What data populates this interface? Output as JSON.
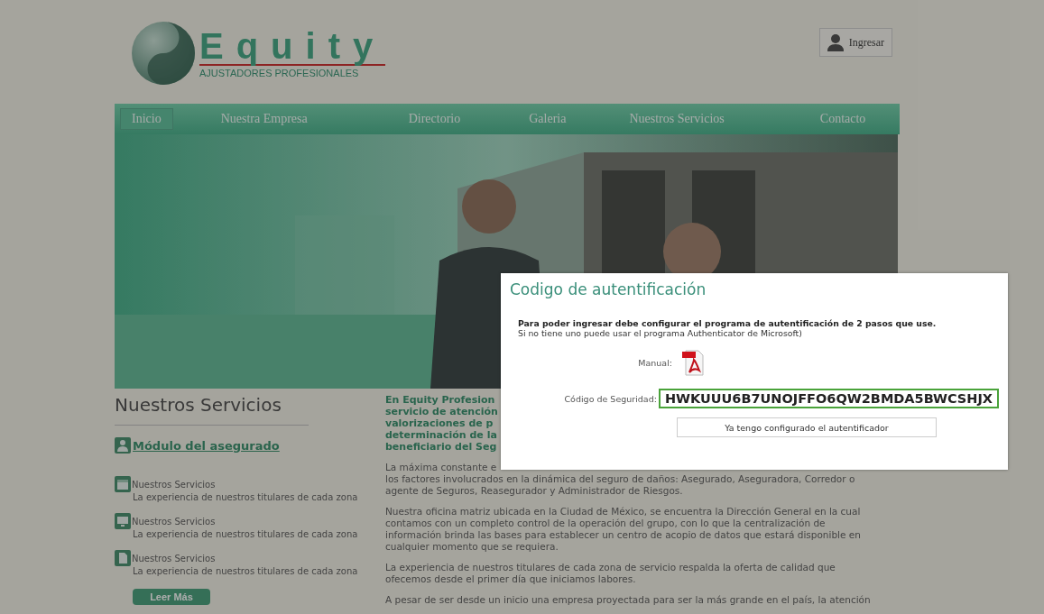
{
  "header": {
    "logo_title": "Equity",
    "logo_subtitle": "AJUSTADORES PROFESIONALES",
    "login_button": "Ingresar"
  },
  "nav": [
    {
      "label": "Inicio",
      "selected": true
    },
    {
      "label": "Nuestra Empresa",
      "selected": false
    },
    {
      "label": "Directorio",
      "selected": false
    },
    {
      "label": "Galeria",
      "selected": false
    },
    {
      "label": "Nuestros Servicios",
      "selected": false
    },
    {
      "label": "Contacto",
      "selected": false
    }
  ],
  "services": {
    "title": "Nuestros Servicios",
    "module_link": "Módulo del asegurado",
    "items": [
      {
        "kind": "calendar",
        "title": "Nuestros Servicios",
        "description": "La experiencia de nuestros titulares de cada zona"
      },
      {
        "kind": "monitor",
        "title": "Nuestros Servicios",
        "description": "La experiencia de nuestros titulares de cada zona"
      },
      {
        "kind": "document",
        "title": "Nuestros Servicios",
        "description": "La experiencia de nuestros titulares de cada zona"
      }
    ],
    "more_button": "Leer Más"
  },
  "article": {
    "intro_lines": [
      "En Equity Profesion",
      "servicio de atención",
      "valorizaciones de p",
      "determinación de la",
      "beneficiario del Seg"
    ],
    "first_paragraph_lines": [
      "La máxima constante e",
      "los factores involucrados en la dinámica del seguro de daños: Asegurado, Aseguradora, Corredor o",
      "agente de Seguros, Reasegurador y Administrador de Riesgos."
    ],
    "paragraphs": [
      "Nuestra oficina matriz ubicada en la Ciudad de México, se encuentra la Dirección General en la cual contamos con un completo control de la operación del grupo, con lo que la centralización de información brinda las bases para establecer un centro de acopio de datos que estará disponible en cualquier momento que se requiera.",
      "La experiencia de nuestros titulares de cada zona de servicio respalda la oferta de calidad que ofecemos desde el primer día que iniciamos labores.",
      "A pesar de ser desde un inicio una empresa proyectada para ser la más grande en el país, la atención"
    ]
  },
  "dialog": {
    "title": "Codigo de autentificación",
    "instructions_bold": "Para poder ingresar debe configurar el programa de autentificación de 2 pasos que use.",
    "instructions": "Si no tiene uno puede usar el programa Authenticator de Microsoft)",
    "manual_label": "Manual:",
    "security_label": "Código de Seguridad:",
    "security_code": "HWKUUU6B7UNOJFFO6QW2BMDA5BWCSHJX",
    "confirm_button": "Ya tengo configurado el autentificador"
  }
}
